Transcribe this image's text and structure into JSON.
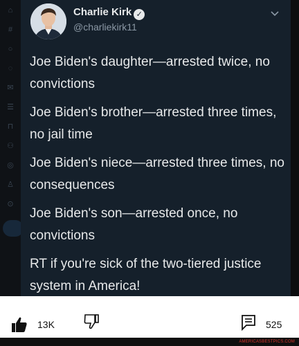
{
  "tweet": {
    "author_name": "Charlie Kirk",
    "author_handle": "@charliekirk11",
    "verified": true,
    "more_icon": "chevron-down-icon",
    "paragraphs": [
      "Joe Biden's daughter—arrested twice, no convictions",
      "Joe Biden's brother—arrested three times, no jail time",
      "Joe Biden's niece—arrested three times, no consequences",
      "Joe Biden's son—arrested once, no convictions",
      "RT if you're sick of the two-tiered justice system in America!"
    ]
  },
  "actions": {
    "likes": "13K",
    "comments": "525",
    "like_icon": "thumbs-up-icon",
    "dislike_icon": "thumbs-down-icon",
    "comment_icon": "comment-icon"
  },
  "sidebar_icons": [
    "home-icon",
    "explore-icon",
    "notifications-icon",
    "messages-icon",
    "bookmarks-icon",
    "lists-icon",
    "profile-icon",
    "more-icon"
  ],
  "watermark": "AMERICASBESTPICS.COM",
  "colors": {
    "tweet_bg": "#15202b",
    "text": "#e7e9ea",
    "secondary_text": "#8b98a5",
    "action_bar_bg": "#ffffff"
  }
}
